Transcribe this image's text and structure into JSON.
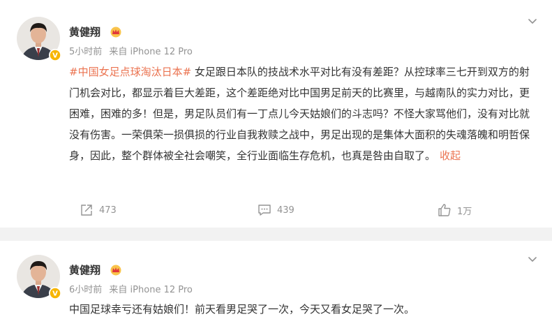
{
  "posts": [
    {
      "user_name": "黄健翔",
      "time": "5小时前",
      "source": "来自 iPhone 12 Pro",
      "hashtag": "#中国女足点球淘汰日本#",
      "text": " 女足跟日本队的技战术水平对比有没有差距？从控球率三七开到双方的射门机会对比，都显示着巨大差距，这个差距绝对比中国男足前天的比赛里，与越南队的实力对比，更困难，困难的多！但是，男足队员们有一丁点儿今天姑娘们的斗志吗？不怪大家骂他们，没有对比就没有伤害。一荣俱荣一损俱损的行业自我救赎之战中，男足出现的是集体大面积的失魂落魄和明哲保身，因此，整个群体被全社会嘲笑，全行业面临生存危机，也真是咎由自取了。",
      "collapse_label": "收起",
      "reposts": "473",
      "comments": "439",
      "likes": "1万"
    },
    {
      "user_name": "黄健翔",
      "time": "6小时前",
      "source": "来自 iPhone 12 Pro",
      "text": "中国足球幸亏还有姑娘们！前天看男足哭了一次，今天又看女足哭了一次。"
    }
  ],
  "icons": {
    "more": "chevron-down-icon",
    "repost": "share-icon",
    "comment": "comment-icon",
    "like": "thumbs-up-icon",
    "member": "crown-icon",
    "verified": "verified-badge-icon"
  },
  "colors": {
    "accent": "#eb7350",
    "text": "#333333",
    "muted": "#939393",
    "divider": "#f2f2f2",
    "verified": "#f7b500",
    "crown": "#e0373b"
  }
}
